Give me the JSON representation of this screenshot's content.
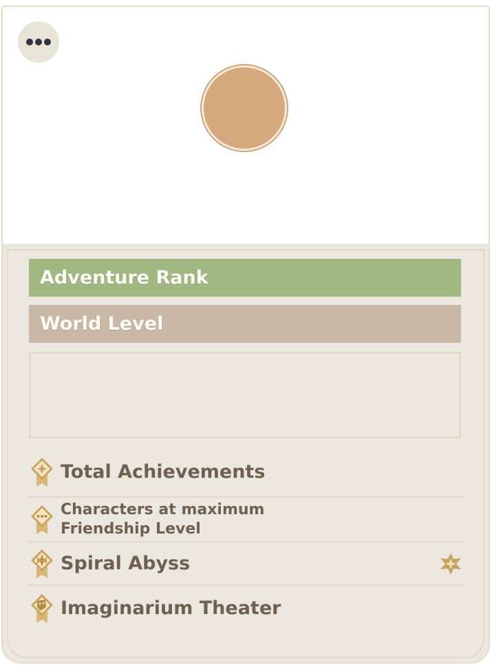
{
  "header": {
    "more_icon": "more-dots-icon",
    "avatar_color": "#d6a87d"
  },
  "bars": {
    "adventure_rank_label": "Adventure Rank",
    "adventure_rank_color": "#a2b883",
    "world_level_label": "World Level",
    "world_level_color": "#c8b8a5"
  },
  "signature": {
    "text": ""
  },
  "stats": [
    {
      "label": "Total Achievements",
      "icon": "achievement-medal-icon"
    },
    {
      "label": "Characters at maximum Friendship Level",
      "icon": "friendship-medal-icon"
    },
    {
      "label": "Spiral Abyss",
      "icon": "abyss-medal-icon",
      "trailing_icon": "abyss-star-icon"
    },
    {
      "label": "Imaginarium Theater",
      "icon": "theater-medal-icon"
    }
  ],
  "colors": {
    "card_background": "#ece8e0",
    "medal_gold": "#c9a25e",
    "label_text": "#6f6152"
  }
}
